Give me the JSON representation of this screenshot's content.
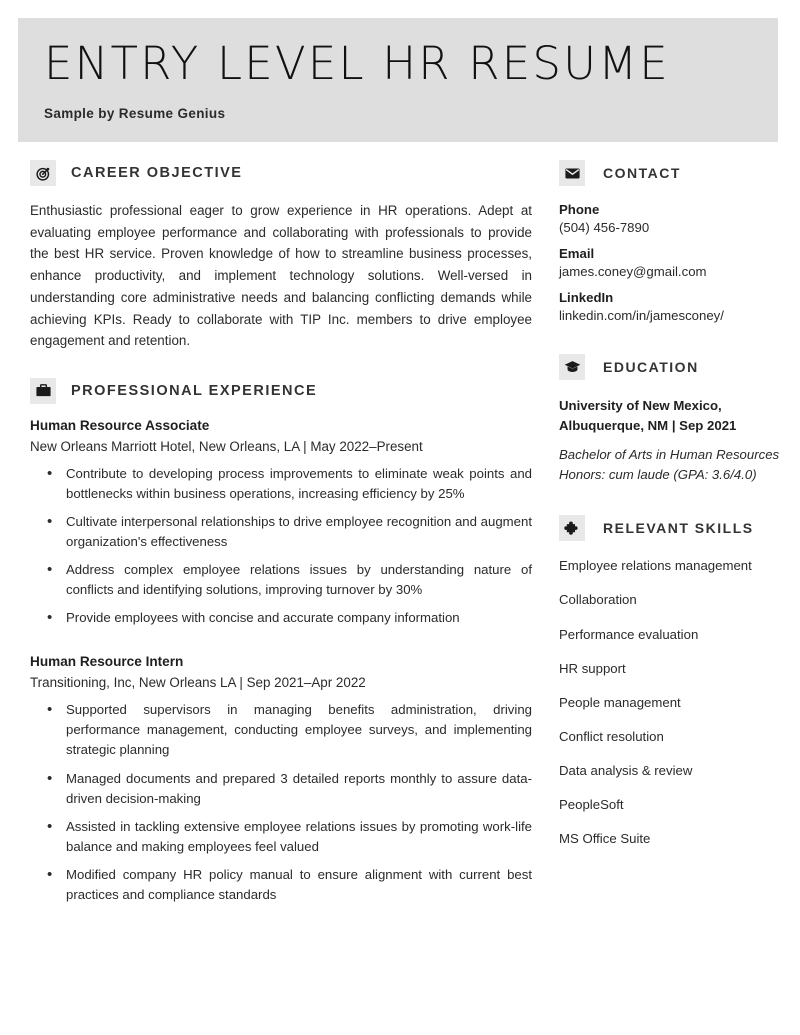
{
  "header": {
    "title": "ENTRY LEVEL HR RESUME",
    "subtitle": "Sample by Resume Genius",
    "band_color": "#dedede"
  },
  "left_column": {
    "objective": {
      "icon": "target-icon",
      "heading": "CAREER OBJECTIVE",
      "text": "Enthusiastic professional eager to grow experience in HR operations. Adept at evaluating employee performance and collaborating with professionals to provide the best HR service. Proven knowledge of how to streamline business processes, enhance productivity, and implement technology solutions. Well-versed in understanding core administrative needs and balancing conflicting demands while achieving KPIs. Ready to collaborate with TIP Inc. members to drive employee engagement and retention."
    },
    "experience": {
      "icon": "briefcase-icon",
      "heading": "PROFESSIONAL EXPERIENCE",
      "jobs": [
        {
          "title": "Human Resource Associate",
          "meta": "New Orleans Marriott Hotel, New Orleans, LA | May 2022–Present",
          "bullets": [
            "Contribute to developing process improvements to eliminate weak points and bottlenecks within business operations, increasing efficiency by 25%",
            "Cultivate interpersonal relationships to drive employee recognition and augment organization's effectiveness",
            "Address complex employee relations issues by understanding nature of conflicts and identifying solutions, improving turnover by 30%",
            "Provide employees with concise and accurate company information"
          ]
        },
        {
          "title": "Human Resource Intern",
          "meta": "Transitioning, Inc, New Orleans LA | Sep 2021–Apr 2022",
          "bullets": [
            "Supported supervisors in managing benefits administration, driving performance management, conducting employee surveys, and implementing strategic planning",
            "Managed documents and prepared 3 detailed reports monthly to assure data-driven decision-making",
            "Assisted in tackling extensive employee relations issues by promoting work-life balance and making employees feel valued",
            "Modified company HR policy manual to ensure alignment with current best practices and compliance standards"
          ]
        }
      ]
    }
  },
  "right_column": {
    "contact": {
      "icon": "envelope-icon",
      "heading": "CONTACT",
      "items": [
        {
          "label": "Phone",
          "value": "(504) 456-7890"
        },
        {
          "label": "Email",
          "value": "james.coney@gmail.com"
        },
        {
          "label": "LinkedIn",
          "value": "linkedin.com/in/jamesconey/"
        }
      ]
    },
    "education": {
      "icon": "graduation-cap-icon",
      "heading": "EDUCATION",
      "school": "University of New Mexico, Albuquerque, NM | Sep 2021",
      "degree": "Bachelor of Arts in Human Resources",
      "honors": "Honors: cum laude (GPA: 3.6/4.0)"
    },
    "skills": {
      "icon": "puzzle-piece-icon",
      "heading": "RELEVANT SKILLS",
      "items": [
        "Employee relations management",
        "Collaboration",
        "Performance evaluation",
        "HR support",
        "People management",
        "Conflict resolution",
        "Data analysis & review",
        "PeopleSoft",
        "MS Office Suite"
      ]
    }
  }
}
